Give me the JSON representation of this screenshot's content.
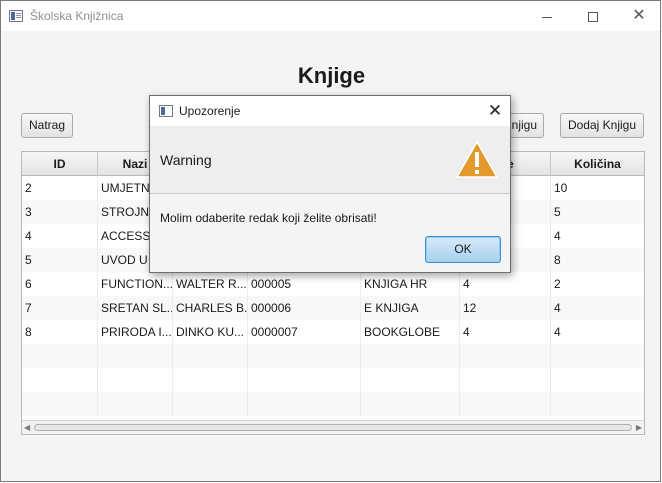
{
  "window": {
    "title": "Školska Knjižnica",
    "controls": {
      "minimize_icon": "minimize-icon",
      "maximize_icon": "maximize-icon",
      "close_glyph": "✕"
    }
  },
  "page": {
    "title": "Knjige",
    "buttons": {
      "back": "Natrag",
      "partial": "njigu",
      "add": "Dodaj Knjigu"
    }
  },
  "table": {
    "headers": [
      "ID",
      "Nazi",
      "",
      "",
      "",
      "nje",
      "Količina"
    ],
    "rows": [
      [
        "2",
        "UMJETNA",
        "",
        "",
        "",
        "",
        "10"
      ],
      [
        "3",
        "STROJNO",
        "",
        "",
        "",
        "",
        "5"
      ],
      [
        "4",
        "ACCESS",
        "",
        "",
        "",
        "",
        "4"
      ],
      [
        "5",
        "UVOD U I",
        "",
        "",
        "",
        "",
        "8"
      ],
      [
        "6",
        "FUNCTION...",
        "WALTER R...",
        "000005",
        "KNJIGA HR",
        "4",
        "2"
      ],
      [
        "7",
        "SRETAN SL...",
        "CHARLES B...",
        "000006",
        "E KNJIGA",
        "12",
        "4"
      ],
      [
        "8",
        "PRIRODA I...",
        "DINKO KU...",
        "0000007",
        "BOOKGLOBE",
        "4",
        "4"
      ]
    ]
  },
  "dialog": {
    "title": "Upozorenje",
    "close_glyph": "✕",
    "header": "Warning",
    "icon": "warning-icon",
    "message": "Molim odaberite redak koji želite obrisati!",
    "ok_label": "OK",
    "colors": {
      "warning_fill": "#e39a2d",
      "ok_border": "#3b8fd6"
    }
  }
}
